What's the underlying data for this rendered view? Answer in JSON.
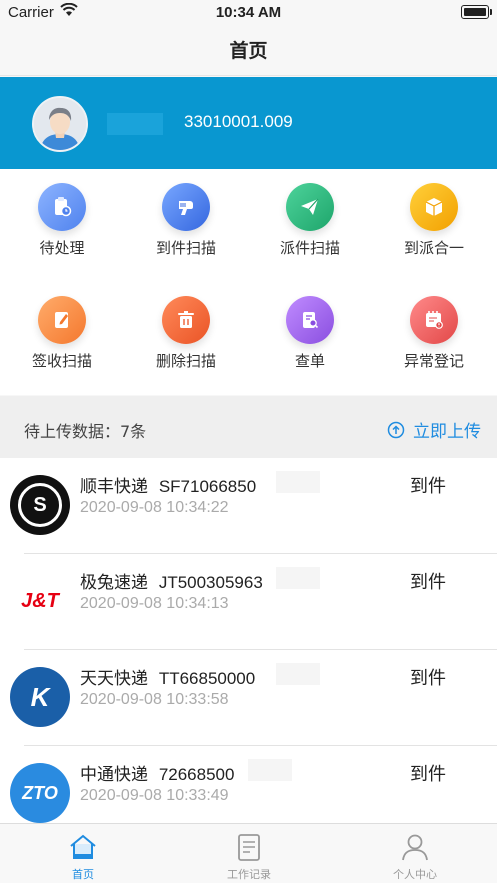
{
  "status_bar": {
    "carrier": "Carrier",
    "time": "10:34 AM"
  },
  "nav": {
    "title": "首页"
  },
  "profile": {
    "account": "33010001.009"
  },
  "menu": [
    {
      "label": "待处理",
      "icon": "clipboard-clock-icon",
      "color": "#5b8df0"
    },
    {
      "label": "到件扫描",
      "icon": "scanner-icon",
      "color": "#3f7ee6"
    },
    {
      "label": "派件扫描",
      "icon": "paper-plane-icon",
      "color": "#27b57a"
    },
    {
      "label": "到派合一",
      "icon": "box-icon",
      "color": "#f5a800"
    },
    {
      "label": "签收扫描",
      "icon": "sign-edit-icon",
      "color": "#f5843c"
    },
    {
      "label": "删除扫描",
      "icon": "trash-icon",
      "color": "#f0632f"
    },
    {
      "label": "查单",
      "icon": "search-document-icon",
      "color": "#9b5de5"
    },
    {
      "label": "异常登记",
      "icon": "calendar-alert-icon",
      "color": "#ef5b5b"
    }
  ],
  "pending": {
    "text": "待上传数据：7条",
    "upload_label": "立即上传"
  },
  "records": [
    {
      "courier": "顺丰快递",
      "tracking": "SF71066850",
      "time": "2020-09-08 10:34:22",
      "status": "到件",
      "logo": "sf-express-logo"
    },
    {
      "courier": "极兔速递",
      "tracking": "JT500305963",
      "time": "2020-09-08 10:34:13",
      "status": "到件",
      "logo": "jt-express-logo"
    },
    {
      "courier": "天天快递",
      "tracking": "TT66850000",
      "time": "2020-09-08 10:33:58",
      "status": "到件",
      "logo": "tiantian-express-logo"
    },
    {
      "courier": "中通快递",
      "tracking": "72668500",
      "time": "2020-09-08 10:33:49",
      "status": "到件",
      "logo": "zto-express-logo"
    }
  ],
  "logo_text": {
    "sf": "S",
    "jt": "J&T",
    "tt": "K",
    "zto": "ZTO"
  },
  "tabs": [
    {
      "label": "首页",
      "icon": "home-icon"
    },
    {
      "label": "工作记录",
      "icon": "document-icon"
    },
    {
      "label": "个人中心",
      "icon": "person-icon"
    }
  ]
}
